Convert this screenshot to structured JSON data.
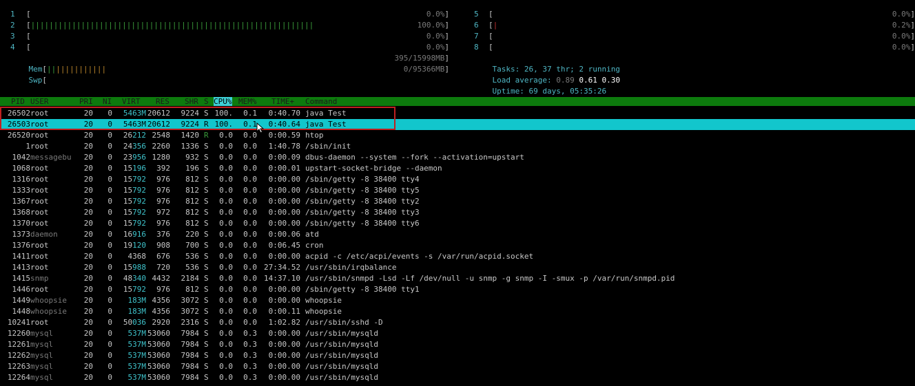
{
  "meters": {
    "cpus_left": [
      {
        "num": "1",
        "bar": "",
        "pct": "0.0%"
      },
      {
        "num": "2",
        "bar": "||||||||||||||||||||||||||||||||||||||||||||||||||||||||||||||",
        "pct": "100.0%"
      },
      {
        "num": "3",
        "bar": "",
        "pct": "0.0%"
      },
      {
        "num": "4",
        "bar": "",
        "pct": "0.0%"
      }
    ],
    "cpus_right": [
      {
        "num": "5",
        "bar": "",
        "pct": "0.0%"
      },
      {
        "num": "6",
        "bar": "|",
        "pct": "0.2%"
      },
      {
        "num": "7",
        "bar": "",
        "pct": "0.0%"
      },
      {
        "num": "8",
        "bar": "",
        "pct": "0.0%"
      }
    ],
    "mem": {
      "label": "Mem",
      "bar_green": "||",
      "bar_orange": "|||||||||||",
      "value": "395/15998MB"
    },
    "swp": {
      "label": "Swp",
      "value": "0/95366MB"
    }
  },
  "summary": {
    "tasks_label": "Tasks: ",
    "tasks_value": "26, 37 thr; 2 running",
    "load_label": "Load average: ",
    "load_1": "0.89",
    "load_5": "0.61",
    "load_15": "0.30",
    "uptime_label": "Uptime: ",
    "uptime_value": "69 days, 05:35:26"
  },
  "columns": {
    "pid": "PID",
    "user": "USER",
    "pri": "PRI",
    "ni": "NI",
    "virt": "VIRT",
    "res": "RES",
    "shr": "SHR",
    "s": "S",
    "cpu": "CPU%",
    "mem": "MEM%",
    "time": "TIME+",
    "command": "Command"
  },
  "processes": [
    {
      "pid": "26502",
      "user": "root",
      "pri": "20",
      "ni": "0",
      "virt": "5463M",
      "res": "20612",
      "shr": "9224",
      "s": "S",
      "cpu": "100.",
      "mem": "0.1",
      "time": "0:40.70",
      "command": "java Test"
    },
    {
      "pid": "26503",
      "user": "root",
      "pri": "20",
      "ni": "0",
      "virt": "5463M",
      "res": "20612",
      "shr": "9224",
      "s": "R",
      "cpu": "100.",
      "mem": "0.1",
      "time": "0:40.64",
      "command": "java Test"
    },
    {
      "pid": "26520",
      "user": "root",
      "pri": "20",
      "ni": "0",
      "virt": "26212",
      "res": "2548",
      "shr": "1420",
      "s": "R",
      "cpu": "0.0",
      "mem": "0.0",
      "time": "0:00.59",
      "command": "htop"
    },
    {
      "pid": "1",
      "user": "root",
      "pri": "20",
      "ni": "0",
      "virt": "24356",
      "res": "2260",
      "shr": "1336",
      "s": "S",
      "cpu": "0.0",
      "mem": "0.0",
      "time": "1:40.78",
      "command": "/sbin/init"
    },
    {
      "pid": "1042",
      "user": "messagebu",
      "pri": "20",
      "ni": "0",
      "virt": "23956",
      "res": "1280",
      "shr": "932",
      "s": "S",
      "cpu": "0.0",
      "mem": "0.0",
      "time": "0:00.09",
      "command": "dbus-daemon --system --fork --activation=upstart"
    },
    {
      "pid": "1068",
      "user": "root",
      "pri": "20",
      "ni": "0",
      "virt": "15196",
      "res": "392",
      "shr": "196",
      "s": "S",
      "cpu": "0.0",
      "mem": "0.0",
      "time": "0:00.01",
      "command": "upstart-socket-bridge --daemon"
    },
    {
      "pid": "1316",
      "user": "root",
      "pri": "20",
      "ni": "0",
      "virt": "15792",
      "res": "976",
      "shr": "812",
      "s": "S",
      "cpu": "0.0",
      "mem": "0.0",
      "time": "0:00.00",
      "command": "/sbin/getty -8 38400 tty4"
    },
    {
      "pid": "1333",
      "user": "root",
      "pri": "20",
      "ni": "0",
      "virt": "15792",
      "res": "976",
      "shr": "812",
      "s": "S",
      "cpu": "0.0",
      "mem": "0.0",
      "time": "0:00.00",
      "command": "/sbin/getty -8 38400 tty5"
    },
    {
      "pid": "1367",
      "user": "root",
      "pri": "20",
      "ni": "0",
      "virt": "15792",
      "res": "976",
      "shr": "812",
      "s": "S",
      "cpu": "0.0",
      "mem": "0.0",
      "time": "0:00.00",
      "command": "/sbin/getty -8 38400 tty2"
    },
    {
      "pid": "1368",
      "user": "root",
      "pri": "20",
      "ni": "0",
      "virt": "15792",
      "res": "972",
      "shr": "812",
      "s": "S",
      "cpu": "0.0",
      "mem": "0.0",
      "time": "0:00.00",
      "command": "/sbin/getty -8 38400 tty3"
    },
    {
      "pid": "1370",
      "user": "root",
      "pri": "20",
      "ni": "0",
      "virt": "15792",
      "res": "976",
      "shr": "812",
      "s": "S",
      "cpu": "0.0",
      "mem": "0.0",
      "time": "0:00.00",
      "command": "/sbin/getty -8 38400 tty6"
    },
    {
      "pid": "1373",
      "user": "daemon",
      "pri": "20",
      "ni": "0",
      "virt": "16916",
      "res": "376",
      "shr": "220",
      "s": "S",
      "cpu": "0.0",
      "mem": "0.0",
      "time": "0:00.06",
      "command": "atd"
    },
    {
      "pid": "1376",
      "user": "root",
      "pri": "20",
      "ni": "0",
      "virt": "19120",
      "res": "908",
      "shr": "700",
      "s": "S",
      "cpu": "0.0",
      "mem": "0.0",
      "time": "0:06.45",
      "command": "cron"
    },
    {
      "pid": "1411",
      "user": "root",
      "pri": "20",
      "ni": "0",
      "virt": "4368",
      "res": "676",
      "shr": "536",
      "s": "S",
      "cpu": "0.0",
      "mem": "0.0",
      "time": "0:00.00",
      "command": "acpid -c /etc/acpi/events -s /var/run/acpid.socket"
    },
    {
      "pid": "1413",
      "user": "root",
      "pri": "20",
      "ni": "0",
      "virt": "15988",
      "res": "720",
      "shr": "536",
      "s": "S",
      "cpu": "0.0",
      "mem": "0.0",
      "time": "27:34.52",
      "command": "/usr/sbin/irqbalance"
    },
    {
      "pid": "1415",
      "user": "snmp",
      "pri": "20",
      "ni": "0",
      "virt": "48340",
      "res": "4432",
      "shr": "2184",
      "s": "S",
      "cpu": "0.0",
      "mem": "0.0",
      "time": "14:37.10",
      "command": "/usr/sbin/snmpd -Lsd -Lf /dev/null -u snmp -g snmp -I -smux -p /var/run/snmpd.pid"
    },
    {
      "pid": "1446",
      "user": "root",
      "pri": "20",
      "ni": "0",
      "virt": "15792",
      "res": "976",
      "shr": "812",
      "s": "S",
      "cpu": "0.0",
      "mem": "0.0",
      "time": "0:00.00",
      "command": "/sbin/getty -8 38400 tty1"
    },
    {
      "pid": "1449",
      "user": "whoopsie",
      "pri": "20",
      "ni": "0",
      "virt": "183M",
      "res": "4356",
      "shr": "3072",
      "s": "S",
      "cpu": "0.0",
      "mem": "0.0",
      "time": "0:00.00",
      "command": "whoopsie"
    },
    {
      "pid": "1448",
      "user": "whoopsie",
      "pri": "20",
      "ni": "0",
      "virt": "183M",
      "res": "4356",
      "shr": "3072",
      "s": "S",
      "cpu": "0.0",
      "mem": "0.0",
      "time": "0:00.11",
      "command": "whoopsie"
    },
    {
      "pid": "10241",
      "user": "root",
      "pri": "20",
      "ni": "0",
      "virt": "50036",
      "res": "2920",
      "shr": "2316",
      "s": "S",
      "cpu": "0.0",
      "mem": "0.0",
      "time": "1:02.82",
      "command": "/usr/sbin/sshd -D"
    },
    {
      "pid": "12260",
      "user": "mysql",
      "pri": "20",
      "ni": "0",
      "virt": "537M",
      "res": "53060",
      "shr": "7984",
      "s": "S",
      "cpu": "0.0",
      "mem": "0.3",
      "time": "0:00.00",
      "command": "/usr/sbin/mysqld"
    },
    {
      "pid": "12261",
      "user": "mysql",
      "pri": "20",
      "ni": "0",
      "virt": "537M",
      "res": "53060",
      "shr": "7984",
      "s": "S",
      "cpu": "0.0",
      "mem": "0.3",
      "time": "0:00.00",
      "command": "/usr/sbin/mysqld"
    },
    {
      "pid": "12262",
      "user": "mysql",
      "pri": "20",
      "ni": "0",
      "virt": "537M",
      "res": "53060",
      "shr": "7984",
      "s": "S",
      "cpu": "0.0",
      "mem": "0.3",
      "time": "0:00.00",
      "command": "/usr/sbin/mysqld"
    },
    {
      "pid": "12263",
      "user": "mysql",
      "pri": "20",
      "ni": "0",
      "virt": "537M",
      "res": "53060",
      "shr": "7984",
      "s": "S",
      "cpu": "0.0",
      "mem": "0.3",
      "time": "0:00.00",
      "command": "/usr/sbin/mysqld"
    },
    {
      "pid": "12264",
      "user": "mysql",
      "pri": "20",
      "ni": "0",
      "virt": "537M",
      "res": "53060",
      "shr": "7984",
      "s": "S",
      "cpu": "0.0",
      "mem": "0.3",
      "time": "0:00.00",
      "command": "/usr/sbin/mysqld"
    }
  ],
  "selected_index": 1,
  "colors": {
    "header_bg": "#0d7a0d",
    "selection_bg": "#12c6cc",
    "highlight_box": "#c02020",
    "label": "#4fb6c4"
  }
}
